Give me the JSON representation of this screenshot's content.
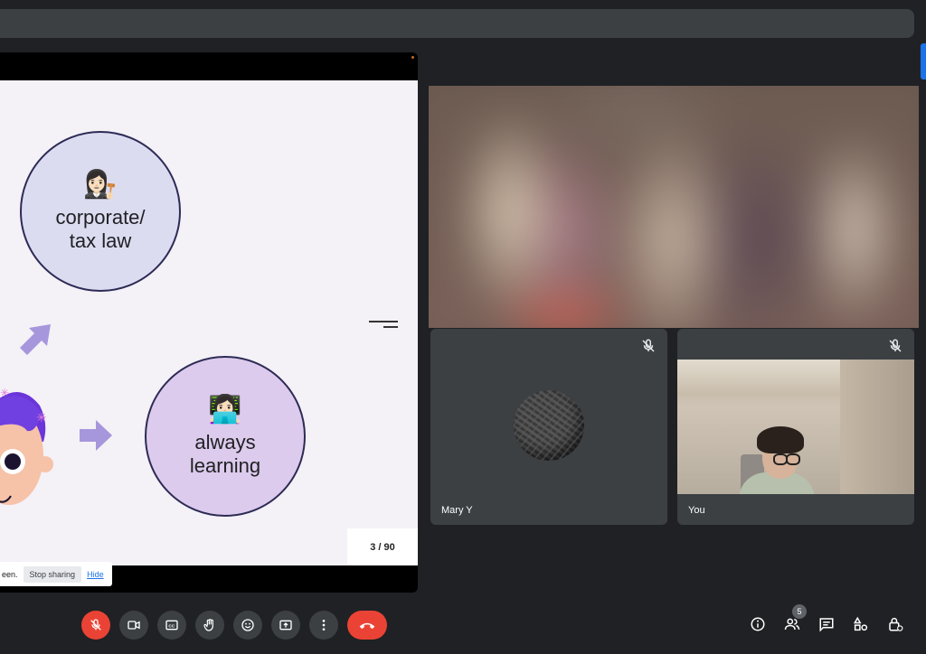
{
  "slide": {
    "circle1": {
      "label_line1": "corporate/",
      "label_line2": "tax law",
      "icon": "lawyer-emoji"
    },
    "circle2": {
      "label_line1": "always",
      "label_line2": "learning",
      "icon": "laptop-emoji"
    },
    "page_number": "3 / 90"
  },
  "share_bar": {
    "text": "een.",
    "stop_label": "Stop sharing",
    "hide_label": "Hide"
  },
  "participants": [
    {
      "name": "Mary Y",
      "muted": true
    },
    {
      "name": "You",
      "muted": true
    }
  ],
  "people_count": "5",
  "colors": {
    "accent": "#1a73e8",
    "end_call": "#ea4335",
    "panel": "#3c4043",
    "bg": "#202124"
  }
}
